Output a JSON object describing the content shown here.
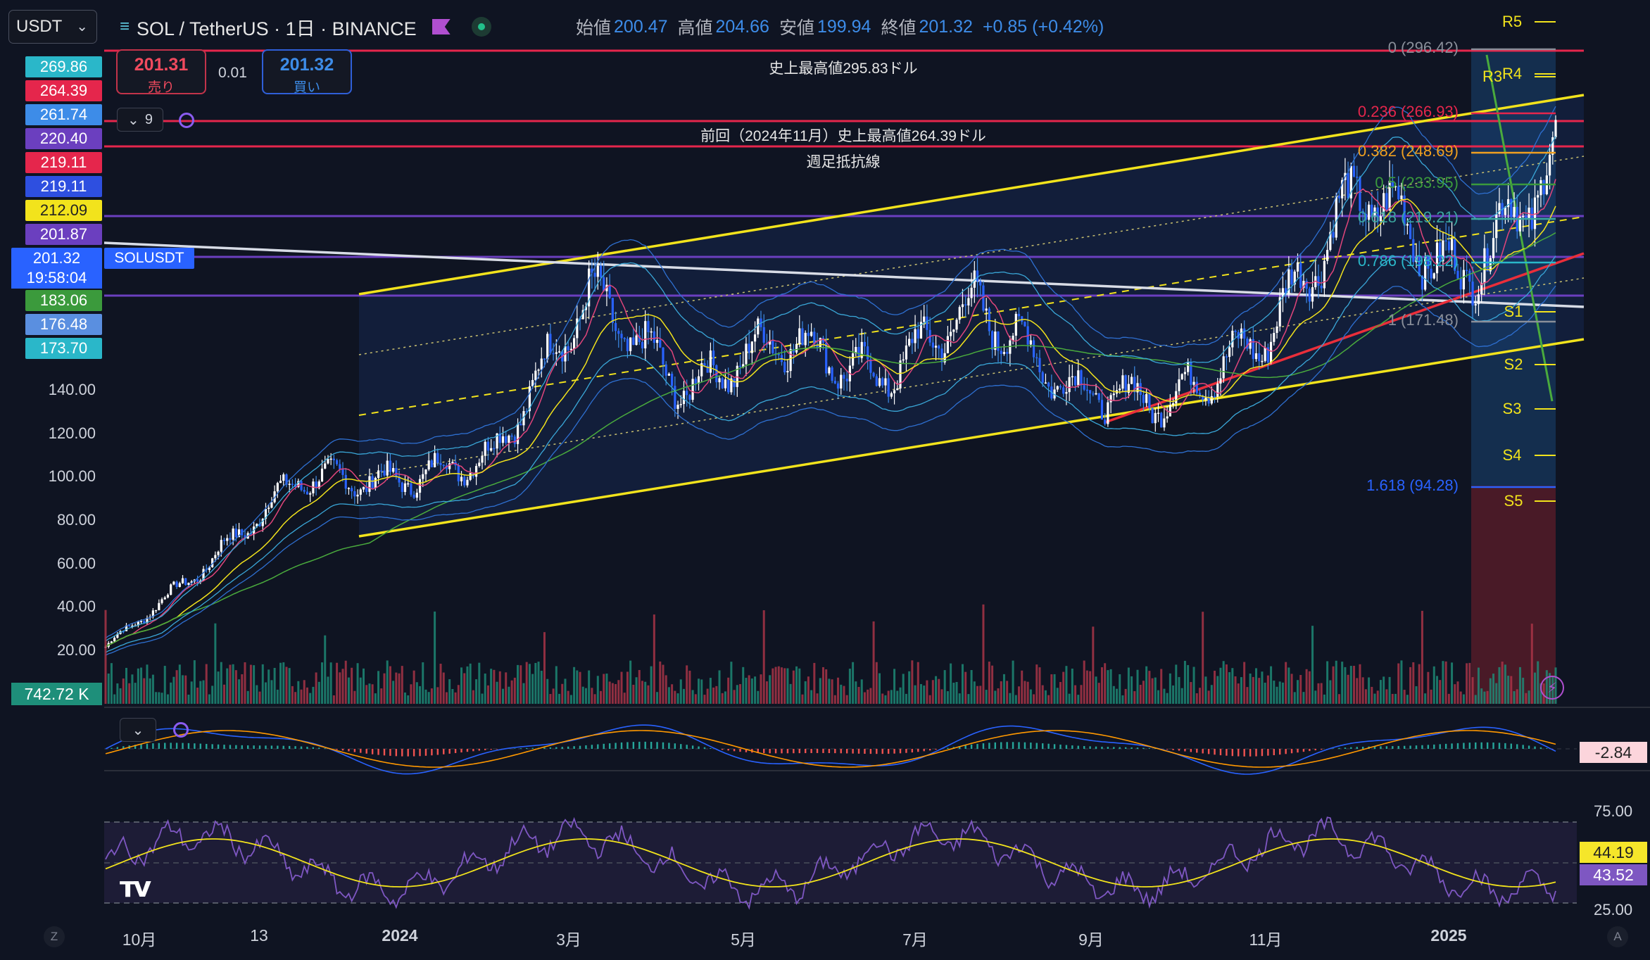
{
  "header": {
    "currency_select": "USDT",
    "title": "SOL / TetherUS · 1日 · BINANCE",
    "ohlc": [
      {
        "label": "始値",
        "value": "200.47"
      },
      {
        "label": "高値",
        "value": "204.66"
      },
      {
        "label": "安値",
        "value": "199.94"
      },
      {
        "label": "終値",
        "value": "201.32"
      }
    ],
    "change": "+0.85 (+0.42%)",
    "sell_price": "201.31",
    "sell_label": "売り",
    "spread": "0.01",
    "buy_price": "201.32",
    "buy_label": "買い",
    "indicator_count": "9"
  },
  "price_scale": {
    "left_tags": [
      {
        "value": "269.86",
        "color": "#2ab7c9"
      },
      {
        "value": "264.39",
        "color": "#e5264c"
      },
      {
        "value": "261.74",
        "color": "#3d8ce8"
      },
      {
        "value": "220.40",
        "color": "#6b3fbf"
      },
      {
        "value": "219.11",
        "color": "#e5264c"
      },
      {
        "value": "219.11",
        "color": "#2e4fe0"
      },
      {
        "value": "212.09",
        "color": "#f2e31c"
      },
      {
        "value": "201.87",
        "color": "#6b3fbf"
      },
      {
        "value": "201.32",
        "color": "#2962ff"
      },
      {
        "value": "183.06",
        "color": "#3b9a3c"
      },
      {
        "value": "176.48",
        "color": "#5a8fe0"
      },
      {
        "value": "173.70",
        "color": "#2ab7c9"
      }
    ],
    "countdown": "19:58:04",
    "symbol_tag": "SOLUSDT",
    "axis_labels": [
      "140.00",
      "120.00",
      "100.00",
      "80.00",
      "60.00",
      "40.00",
      "20.00"
    ],
    "volume_tag": "742.72 K"
  },
  "time_axis": [
    "10月",
    "13",
    "2024",
    "3月",
    "5月",
    "7月",
    "9月",
    "11月",
    "2025"
  ],
  "annotations": {
    "ath": "史上最高値295.83ドル",
    "prev_ath": "前回（2024年11月）史上最高値264.39ドル",
    "weekly_resistance": "週足抵抗線"
  },
  "fib_levels": [
    {
      "label": "0 (296.42)",
      "color": "#8a8f9a"
    },
    {
      "label": "0.236 (266.93)",
      "color": "#e5264c"
    },
    {
      "label": "0.382 (248.69)",
      "color": "#f0a020"
    },
    {
      "label": "0.5 (233.95)",
      "color": "#3b9a3c"
    },
    {
      "label": "0.618 (219.21)",
      "color": "#3ba7a0"
    },
    {
      "label": "0.786 (198.22)",
      "color": "#2ab7c9"
    },
    {
      "label": "1 (171.48)",
      "color": "#8a8f9a"
    },
    {
      "label": "1.618 (94.28)",
      "color": "#2962ff"
    }
  ],
  "pivots": {
    "resistance": [
      "R5",
      "R4",
      "R3"
    ],
    "support": [
      "S1",
      "S2",
      "S3",
      "S4",
      "S5"
    ]
  },
  "macd_pane": {
    "value": "-2.84"
  },
  "rsi_pane": {
    "upper": "75.00",
    "lower": "25.00",
    "rsi_ma": "44.19",
    "rsi": "43.52"
  },
  "corner_buttons": {
    "z": "Z",
    "a": "A"
  },
  "chart_data": {
    "type": "candlestick",
    "symbol": "SOL / TetherUS",
    "interval": "1日",
    "exchange": "BINANCE",
    "ylim": [
      10,
      300
    ],
    "x_ticks": [
      "10月",
      "13",
      "2024",
      "3月",
      "5月",
      "7月",
      "9月",
      "11月",
      "2025"
    ],
    "close_series_approx": {
      "months": [
        "2023-10",
        "2023-11",
        "2023-12",
        "2024-01",
        "2024-02",
        "2024-03",
        "2024-04",
        "2024-05",
        "2024-06",
        "2024-07",
        "2024-08",
        "2024-09",
        "2024-10",
        "2024-11",
        "2024-12",
        "2025-01"
      ],
      "values": [
        22,
        58,
        100,
        98,
        110,
        185,
        140,
        165,
        145,
        180,
        140,
        135,
        165,
        235,
        190,
        245
      ]
    },
    "last": {
      "open": 200.47,
      "high": 204.66,
      "low": 199.94,
      "close": 201.32,
      "change": 0.85,
      "change_pct": 0.42
    },
    "horizontal_levels": [
      {
        "name": "史上最高値",
        "value": 295.83
      },
      {
        "name": "前回史上最高値",
        "value": 264.39
      },
      {
        "name": "週足抵抗線",
        "value": 261.74
      }
    ]
  }
}
